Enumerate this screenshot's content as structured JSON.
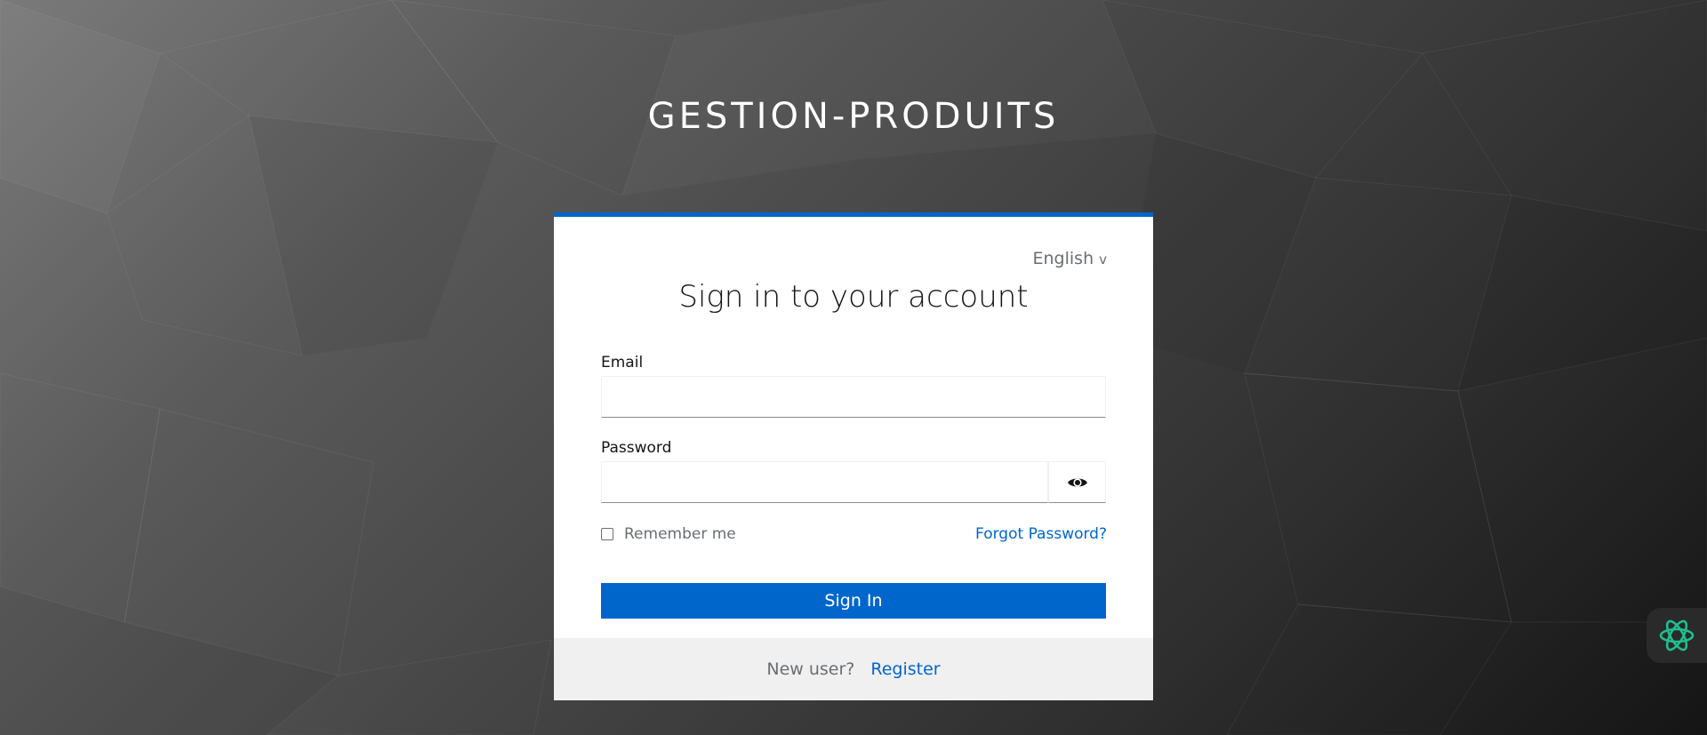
{
  "realm": {
    "title": "GESTION-PRODUITS"
  },
  "locale": {
    "current": "English",
    "chevron": "v"
  },
  "form": {
    "heading": "Sign in to your account",
    "email": {
      "label": "Email",
      "value": "",
      "placeholder": ""
    },
    "password": {
      "label": "Password",
      "value": "",
      "placeholder": "",
      "toggle_icon": "eye-icon"
    },
    "remember_label": "Remember me",
    "remember_checked": false,
    "forgot_label": "Forgot Password?",
    "submit_label": "Sign In"
  },
  "footer": {
    "new_user_text": "New user?",
    "register_label": "Register"
  },
  "widget": {
    "icon": "assistant-knot-icon"
  },
  "colors": {
    "accent": "#0066cc",
    "widget_icon": "#1fbf8f",
    "card_background": "#ffffff",
    "footer_background": "#f0f0f0"
  }
}
